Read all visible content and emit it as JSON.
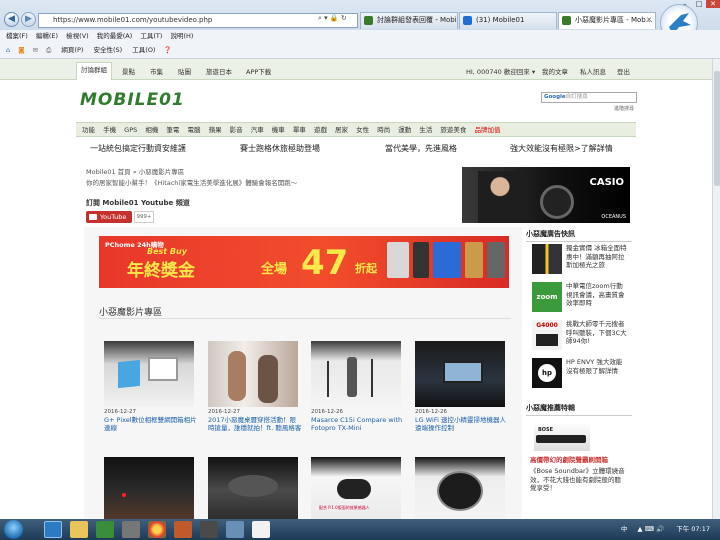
{
  "browser": {
    "url": "https://www.mobile01.com/youtubevideo.php",
    "tabs": [
      {
        "label": "討論群組發表回覆 - Mobi...",
        "active": false,
        "icon_color": "#3b7a2a"
      },
      {
        "label": "(31) Mobile01",
        "active": false,
        "icon_color": "#1e6fd1"
      },
      {
        "label": "小惡魔影片專區 - Mob...",
        "active": true,
        "icon_color": "#3b7a2a"
      }
    ],
    "menu": [
      "檔案(F)",
      "編輯(E)",
      "檢視(V)",
      "我的最愛(A)",
      "工具(T)",
      "說明(H)"
    ],
    "commands": [
      "網頁(P)",
      "安全性(S)",
      "工具(O)"
    ],
    "addr_icons": "⌕ ▾ 🔒 ↻"
  },
  "topnav": {
    "items": [
      "討論群組",
      "景點",
      "市集",
      "貼圖",
      "旅遊日本",
      "APP下載"
    ],
    "user": "HI, 000740 歡迎回來",
    "dropdown": "▾",
    "links": [
      "我的文章",
      "私人訊息",
      "登出"
    ]
  },
  "logo": "MOBILE01",
  "search": {
    "placeholder": "自訂搜尋",
    "advanced": "進階搜尋"
  },
  "categories": [
    "功能",
    "手機",
    "GPS",
    "相機",
    "筆電",
    "電腦",
    "蘋果",
    "影音",
    "汽車",
    "機車",
    "單車",
    "遊戲",
    "居家",
    "女性",
    "時尚",
    "運動",
    "生活",
    "旅遊美食",
    "品牌加值"
  ],
  "category_highlight": "品牌加值",
  "promos": [
    "一站統包搞定行動資安維護",
    "賽士跑格休旅極助登場",
    "當代美學，先進風格",
    "強大效能沒有極限>了解詳情"
  ],
  "breadcrumb": "Mobile01 首頁 » 小惡魔影片專區",
  "tagline": "你的居家智能小幫手！《Hitachi家電生活美學進化展》體驗會報名開跑～",
  "casio": {
    "brand": "CASIO",
    "sub": "OCEANUS"
  },
  "subscribe": {
    "title": "訂閱 Mobile01 Youtube 頻道",
    "button": "YouTube",
    "count": "999+"
  },
  "banner": {
    "pchome": "PChome 24h購物",
    "bestbuy": "Best Buy",
    "main": "年終獎金",
    "all": "全場",
    "number": "47",
    "suffix": "折起"
  },
  "section_title": "小惡魔影片專區",
  "videos": [
    {
      "date": "2016-12-27",
      "title": "G+ Pixel數位相框雙網開箱相片連線"
    },
    {
      "date": "2016-12-27",
      "title": "2017小惡魔桌曆穿搭活動！限時搶量，誰穩就拍！ft. 聽風格客"
    },
    {
      "date": "2016-12-26",
      "title": "Masarce C15i Compare with Fotopro TX-Mini"
    },
    {
      "date": "2016-12-26",
      "title": "LG WiFi 速控小精靈掃地機器人遠端操作控制"
    }
  ],
  "videos_row2_captions": [
    "",
    "",
    "配合 P.1.0版面的效果感器人",
    ""
  ],
  "sidebar": {
    "ad_header": "小惡魔廣告快訊",
    "ads": [
      {
        "text": "獨金實價 冰箱全面特惠中！滿額再抽阿拉斯加極光之旅"
      },
      {
        "text": "中華電信zoom行動視訊會議，高畫質會效率即時",
        "logo": "zoom"
      },
      {
        "text": "挑戰大師零千元搜者呼叫聽裝，下個3C大師94你!",
        "logo": "G4000"
      },
      {
        "text": "HP ENVY 強大效能沒有極限了解詳情",
        "logo": "hp"
      }
    ],
    "rec_header": "小惡魔推薦特輯",
    "rec_title": "高價帶幻的劇院聲霸刷開箱",
    "rec_text": "《Bose Soundbar》立體環繞音效，不花大錢也能有劇院般的聽覺享受！"
  },
  "taskbar": {
    "lang": "中",
    "time": "下午 07:17",
    "tray_icons": "▲ ⌨ 🔊"
  }
}
